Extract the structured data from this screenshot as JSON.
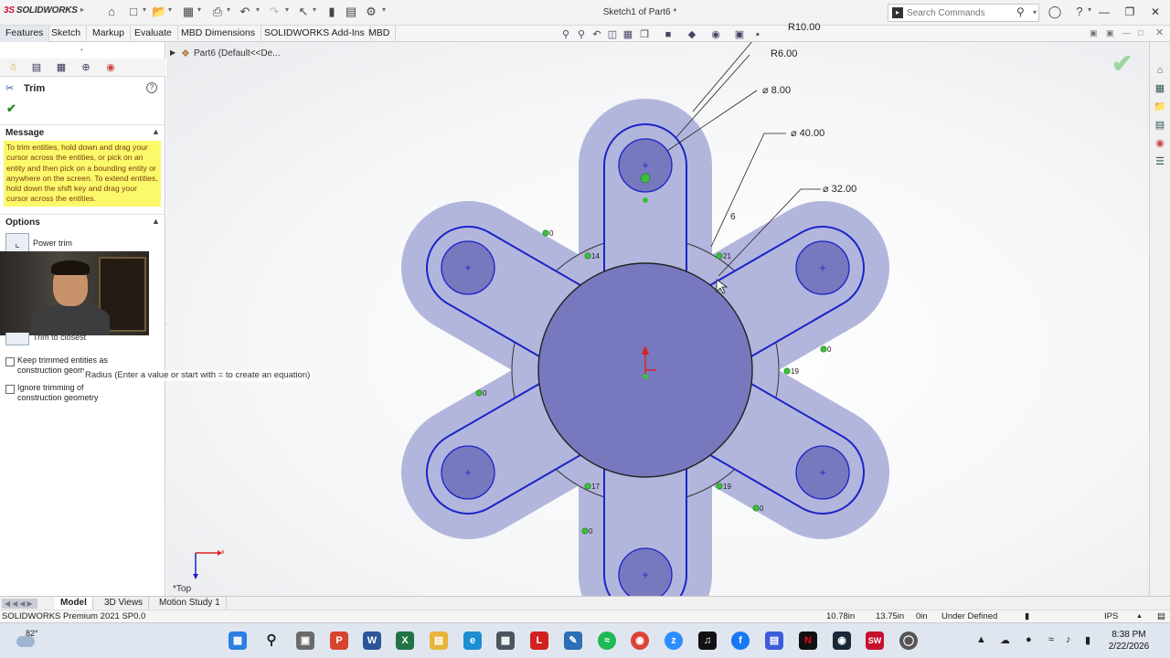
{
  "app": {
    "logo_ds": "3S",
    "logo_sw": "SOLIDWORKS",
    "document_title": "Sketch1 of Part6 *",
    "search_placeholder": "Search Commands"
  },
  "menu_tabs": [
    "Features",
    "Sketch",
    "Markup",
    "Evaluate",
    "MBD Dimensions",
    "SOLIDWORKS Add-Ins",
    "MBD"
  ],
  "active_menu_tab": "Features",
  "feature_tree": {
    "label": "Part6  (Default<<De..."
  },
  "property_manager": {
    "title": "Trim",
    "message_header": "Message",
    "message": "To trim entities, hold down and drag your cursor across the entities, or pick on an entity and then pick on a bounding entity or anywhere on the screen.  To extend entities, hold down the shift key and drag your cursor across the entities.",
    "options_header": "Options",
    "power_trim": "Power trim",
    "trim_closest": "Trim to closest",
    "keep_trimmed": "Keep trimmed entities as construction geom",
    "ignore_trimming": "Ignore trimming of construction geometry"
  },
  "tooltip": "Radius (Enter a value or start with = to create an equation)",
  "dimensions": {
    "r10": "R10.00",
    "r6": "R6.00",
    "d8": "⌀ 8.00",
    "d40": "⌀ 40.00",
    "d32": "⌀ 32.00",
    "six": "6"
  },
  "relation_labels": [
    "14",
    "21",
    "19",
    "17",
    "19",
    "0",
    "0",
    "0",
    "0",
    "0"
  ],
  "view_label": "*Top",
  "bottom_tabs": [
    "Model",
    "3D Views",
    "Motion Study 1"
  ],
  "active_bottom_tab": "Model",
  "status": {
    "product": "SOLIDWORKS Premium 2021 SP0.0",
    "x": "10.78in",
    "y": "13.75in",
    "z": "0in",
    "state": "Under Defined",
    "units": "IPS"
  },
  "taskbar": {
    "temperature": "82°",
    "time": "8:38 PM",
    "date": "2/22/2026"
  },
  "colors": {
    "sketch_fill": "#b3b6dc",
    "sketch_line": "#1a24c8",
    "hole_fill": "#7778bd",
    "relation_green": "#3dbf3d",
    "message_bg": "#fbf86a"
  }
}
